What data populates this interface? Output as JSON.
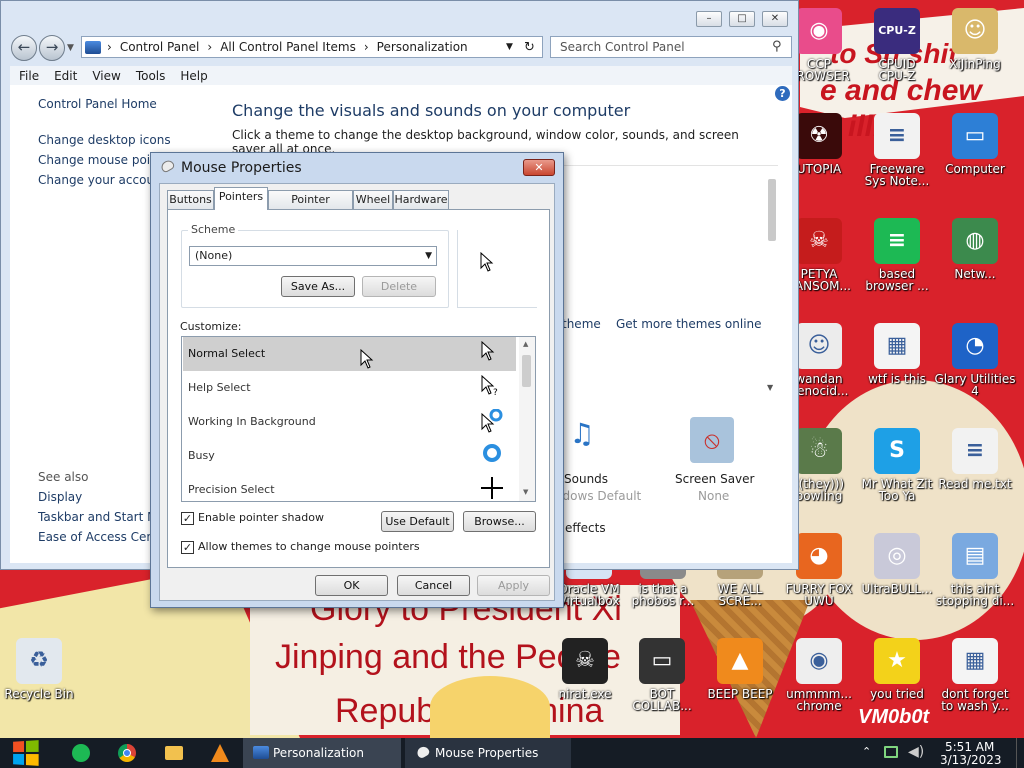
{
  "colors": {
    "desktop": "#d9222b",
    "accent": "#3b78c7",
    "taskbar": "#151c25"
  },
  "wallpaper": {
    "line1": "to Sh shit",
    "line2": "e and chew",
    "line3": "illin",
    "line4": "Glory to President Xi",
    "line5": "Jinping and the People",
    "line6": "Republic of China",
    "watermark": "VM0b0t"
  },
  "desktop_icons": [
    {
      "label": "CCP\nBROWSER",
      "icon": "ccp-browser-icon",
      "bg": "#e94c8b",
      "glyph": "◉"
    },
    {
      "label": "CPUID\nCPU-Z",
      "icon": "cpuz-icon",
      "bg": "#3a2c7e",
      "glyph": "CPU-Z"
    },
    {
      "label": "XiJinPing",
      "icon": "folder-person-icon",
      "bg": "#d9b86b",
      "glyph": "☺"
    },
    {
      "label": "UTOPIA",
      "icon": "utopia-icon",
      "bg": "#3a0a0a",
      "glyph": "☢"
    },
    {
      "label": "Freeware\nSys Note...",
      "icon": "text-file-icon",
      "bg": "#f2f2f2",
      "glyph": "≡"
    },
    {
      "label": "Computer",
      "icon": "computer-icon",
      "bg": "#2d7fd6",
      "glyph": "▭"
    },
    {
      "label": "PETYA\nRANSOM...",
      "icon": "skull-icon",
      "bg": "#c51c1c",
      "glyph": "☠"
    },
    {
      "label": "based\nbrowser ...",
      "icon": "chat-icon",
      "bg": "#1db954",
      "glyph": "≡"
    },
    {
      "label": "Netw...",
      "icon": "network-icon",
      "bg": "#3c8a4d",
      "glyph": "◍"
    },
    {
      "label": "wandan\ngenocid...",
      "icon": "meme-icon",
      "bg": "#ececec",
      "glyph": "☺"
    },
    {
      "label": "wtf is this",
      "icon": "notepad-icon",
      "bg": "#f4f4f4",
      "glyph": "▦"
    },
    {
      "label": "Glary Utilities\n4",
      "icon": "glary-icon",
      "bg": "#1e63c7",
      "glyph": "◔"
    },
    {
      "label": "((they)))\nbowling",
      "icon": "santa-icon",
      "bg": "#5a7a4a",
      "glyph": "☃"
    },
    {
      "label": "Mr What Zit\nToo Ya",
      "icon": "skype-icon",
      "bg": "#1ea0e6",
      "glyph": "S"
    },
    {
      "label": "Read me.txt",
      "icon": "text-file-icon",
      "bg": "#f2f2f2",
      "glyph": "≡"
    },
    {
      "label": "Oracle VM\nVirtualbox",
      "icon": "virtualbox-icon",
      "bg": "#d6e4f5",
      "glyph": "▣"
    },
    {
      "label": "is that a\nphobos r...",
      "icon": "app-icon",
      "bg": "#8a8a8a",
      "glyph": "▣"
    },
    {
      "label": "WE ALL\nSCRE...",
      "icon": "app-icon",
      "bg": "#b6a27a",
      "glyph": "▣"
    },
    {
      "label": "FURRY FOX\nUWU",
      "icon": "firefox-icon",
      "bg": "#e8661f",
      "glyph": "◕"
    },
    {
      "label": "UltraBULL...",
      "icon": "disc-icon",
      "bg": "#c9c9d9",
      "glyph": "◎"
    },
    {
      "label": "this aint\nstopping di...",
      "icon": "installer-icon",
      "bg": "#7aa9e0",
      "glyph": "▤"
    },
    {
      "label": "Recycle Bin",
      "icon": "recycle-bin-icon",
      "bg": "#e2e8ee",
      "glyph": "♻"
    },
    {
      "label": "nirat.exe",
      "icon": "skull-icon",
      "bg": "#222",
      "glyph": "☠"
    },
    {
      "label": "BOT\nCOLLAB...",
      "icon": "monitor-icon",
      "bg": "#333",
      "glyph": "▭"
    },
    {
      "label": "BEEP BEEP",
      "icon": "vlc-icon",
      "bg": "#f08a1c",
      "glyph": "▲"
    },
    {
      "label": "ummmm...\nchrome",
      "icon": "chrome-icon",
      "bg": "#eeeeee",
      "glyph": "◉"
    },
    {
      "label": "you tried",
      "icon": "star-icon",
      "bg": "#f3d21a",
      "glyph": "★"
    },
    {
      "label": "dont forget\nto wash y...",
      "icon": "calendar-icon",
      "bg": "#f4f4f4",
      "glyph": "▦"
    }
  ],
  "explorer": {
    "title_buttons": {
      "minimize": "–",
      "maximize": "□",
      "close": "✕"
    },
    "breadcrumb": [
      "Control Panel",
      "All Control Panel Items",
      "Personalization"
    ],
    "search_placeholder": "Search Control Panel",
    "menu": [
      "File",
      "Edit",
      "View",
      "Tools",
      "Help"
    ],
    "left_links": [
      "Control Panel Home",
      "Change desktop icons",
      "Change mouse pointers",
      "Change your account picture"
    ],
    "see_also_title": "See also",
    "see_also": [
      "Display",
      "Taskbar and Start Menu",
      "Ease of Access Center"
    ],
    "heading": "Change the visuals and sounds on your computer",
    "subheading": "Click a theme to change the desktop background, window color, sounds, and screen saver all at once.",
    "theme_link_fragment": "theme",
    "get_more_themes": "Get more themes online",
    "sounds_label": "Sounds",
    "sounds_value": "Windows Default",
    "screensaver_label": "Screen Saver",
    "screensaver_value": "None",
    "effects_fragment": "effects"
  },
  "dialog": {
    "title": "Mouse Properties",
    "tabs": [
      "Buttons",
      "Pointers",
      "Pointer Options",
      "Wheel",
      "Hardware"
    ],
    "active_tab": "Pointers",
    "scheme_label": "Scheme",
    "scheme_value": "(None)",
    "save_as": "Save As...",
    "delete": "Delete",
    "customize_label": "Customize:",
    "pointers": [
      {
        "name": "Normal Select",
        "selected": true
      },
      {
        "name": "Help Select",
        "selected": false
      },
      {
        "name": "Working In Background",
        "selected": false
      },
      {
        "name": "Busy",
        "selected": false
      },
      {
        "name": "Precision Select",
        "selected": false
      }
    ],
    "enable_shadow": "Enable pointer shadow",
    "allow_themes": "Allow themes to change mouse pointers",
    "use_default": "Use Default",
    "browse": "Browse...",
    "ok": "OK",
    "cancel": "Cancel",
    "apply": "Apply"
  },
  "taskbar": {
    "tasks": [
      "Personalization",
      "Mouse Properties"
    ],
    "time": "5:51 AM",
    "date": "3/13/2023"
  }
}
